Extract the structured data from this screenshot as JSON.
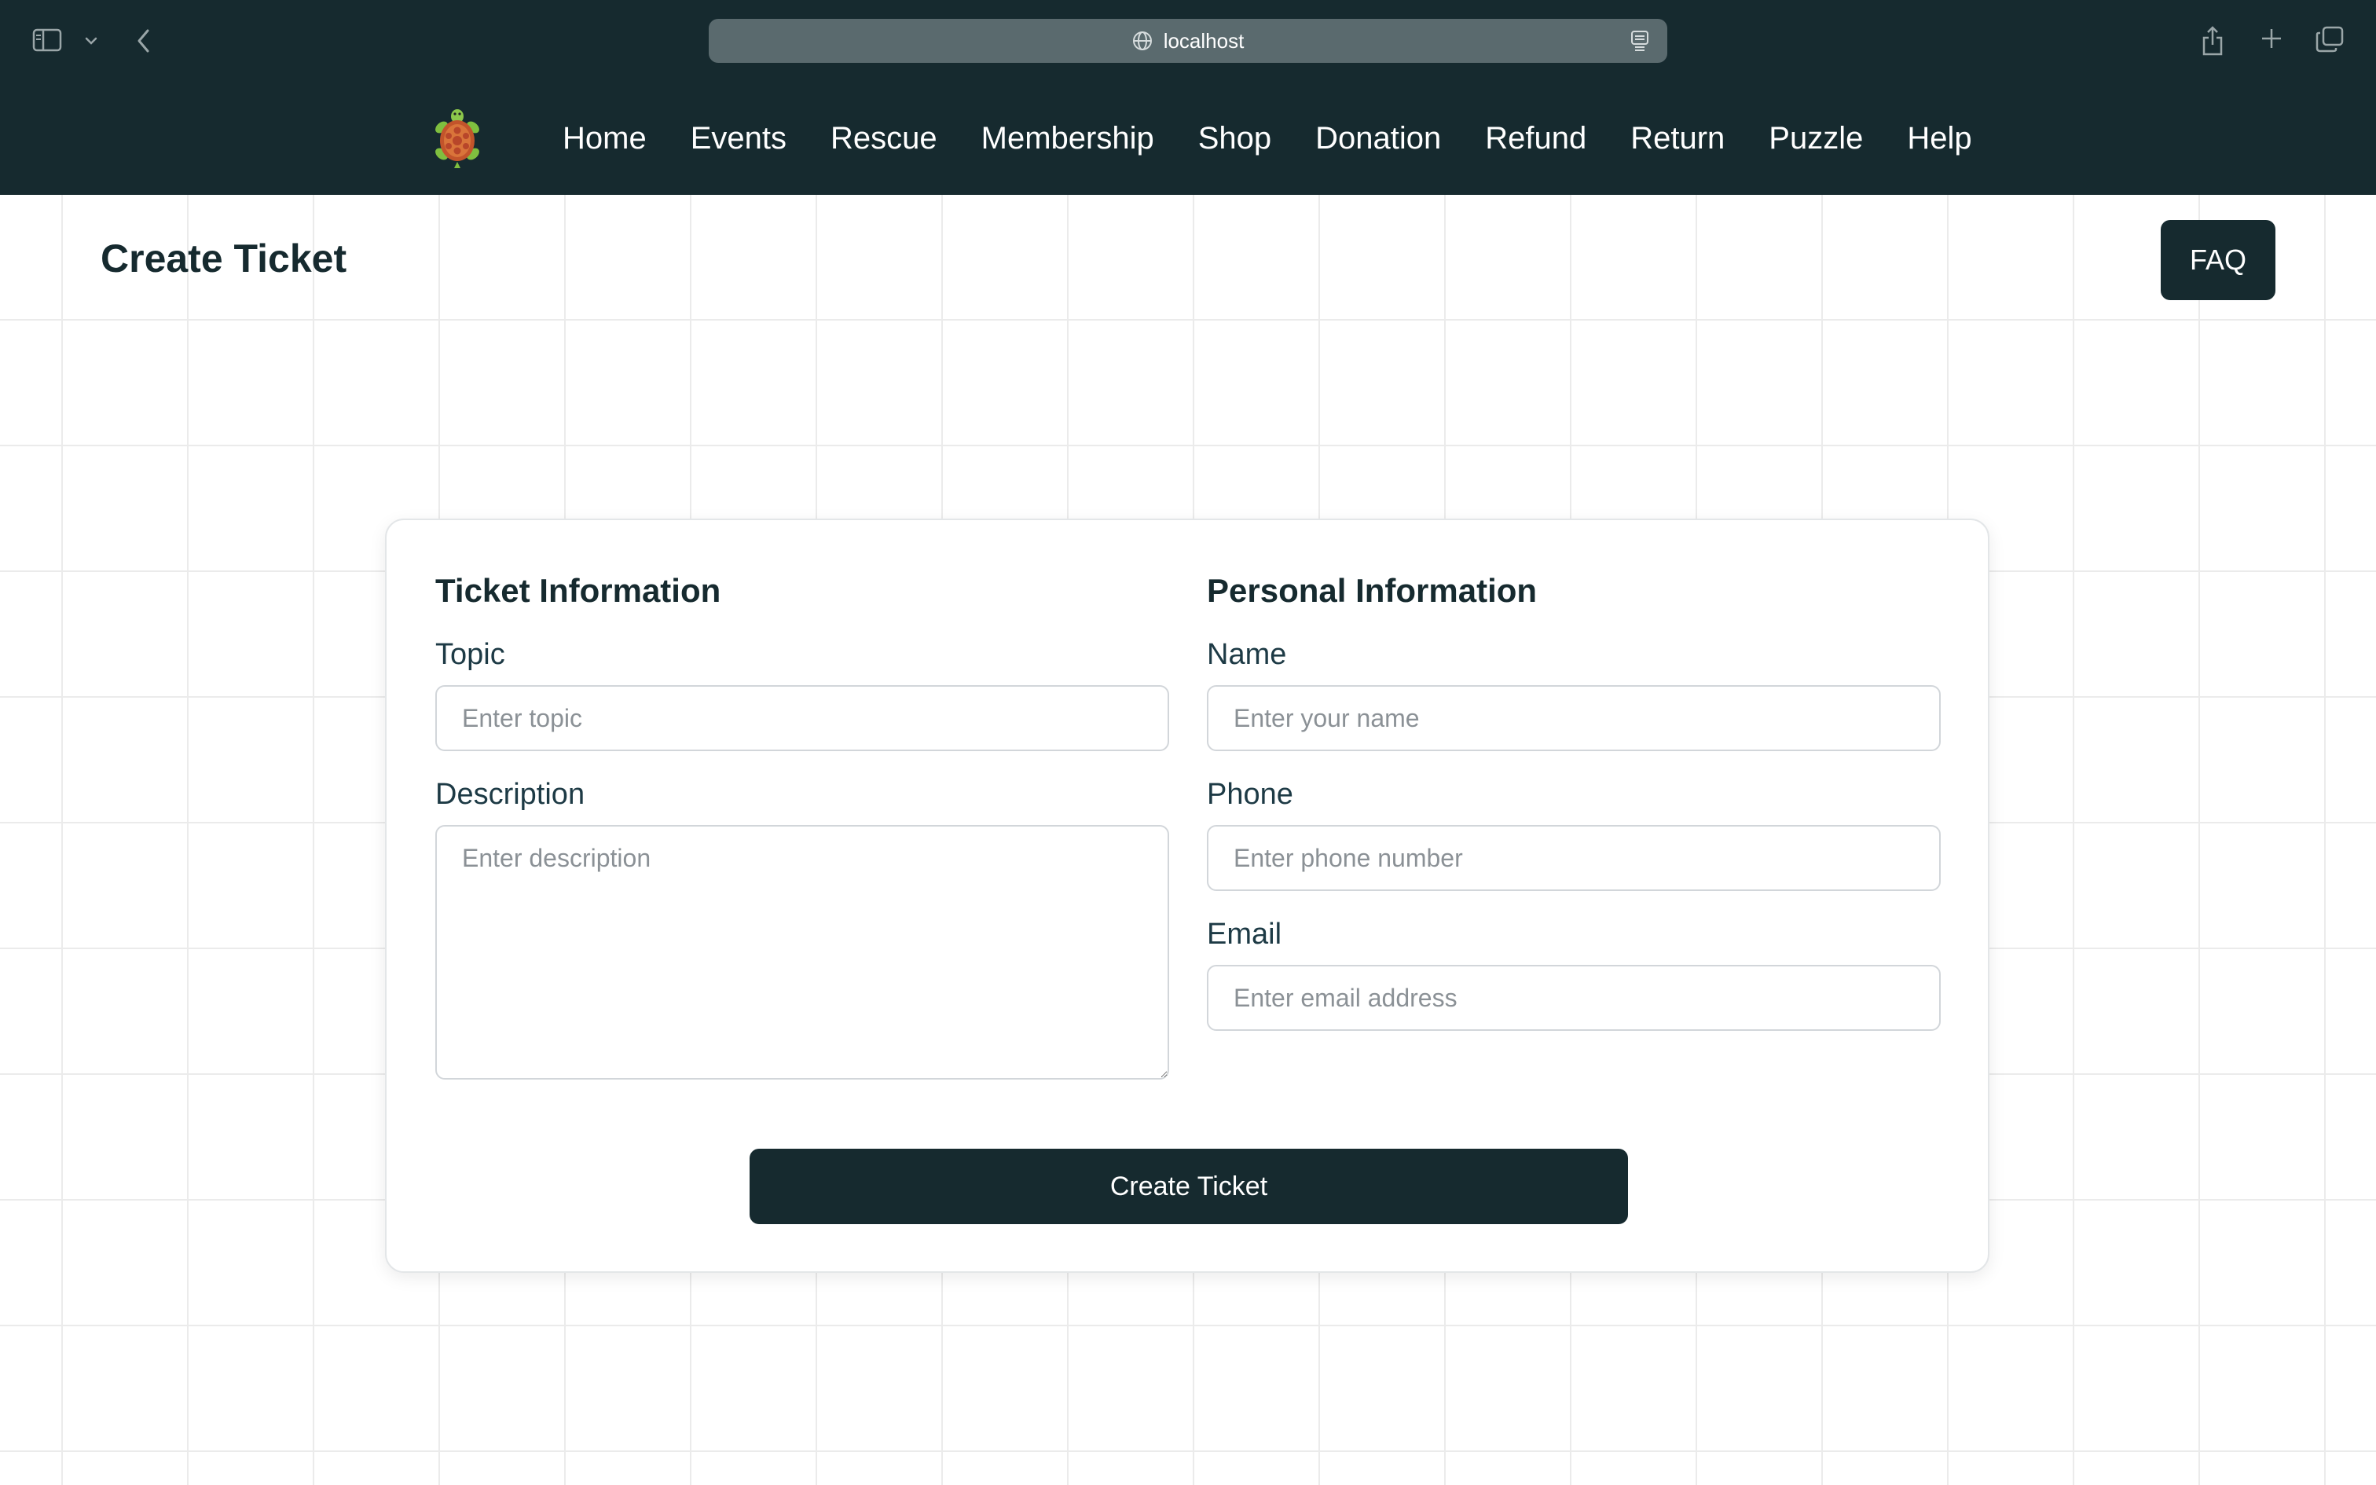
{
  "browser": {
    "url": "localhost",
    "icons": {
      "sidebar": "sidebar-icon",
      "dropdown": "chevron-down-icon",
      "back": "chevron-left-icon",
      "site": "globe-icon",
      "reader": "reader-icon",
      "share": "share-icon",
      "new_tab": "plus-icon",
      "tabs": "tabs-overview-icon"
    }
  },
  "nav": {
    "logo": "turtle-logo",
    "items": [
      {
        "label": "Home"
      },
      {
        "label": "Events"
      },
      {
        "label": "Rescue"
      },
      {
        "label": "Membership"
      },
      {
        "label": "Shop"
      },
      {
        "label": "Donation"
      },
      {
        "label": "Refund"
      },
      {
        "label": "Return"
      },
      {
        "label": "Puzzle"
      },
      {
        "label": "Help"
      }
    ]
  },
  "page": {
    "title": "Create Ticket",
    "faq_label": "FAQ"
  },
  "form": {
    "ticket_section_title": "Ticket Information",
    "topic_label": "Topic",
    "topic_placeholder": "Enter topic",
    "topic_value": "",
    "description_label": "Description",
    "description_placeholder": "Enter description",
    "description_value": "",
    "personal_section_title": "Personal Information",
    "name_label": "Name",
    "name_placeholder": "Enter your name",
    "name_value": "",
    "phone_label": "Phone",
    "phone_placeholder": "Enter phone number",
    "phone_value": "",
    "email_label": "Email",
    "email_placeholder": "Enter email address",
    "email_value": "",
    "submit_label": "Create Ticket"
  },
  "colors": {
    "header_bg": "#162a2f",
    "url_bar_bg": "#5a6a6e",
    "primary_button": "#162a2f",
    "label_text": "#1d3a45",
    "placeholder_text": "#8b9196",
    "grid_line": "#ebebeb"
  }
}
